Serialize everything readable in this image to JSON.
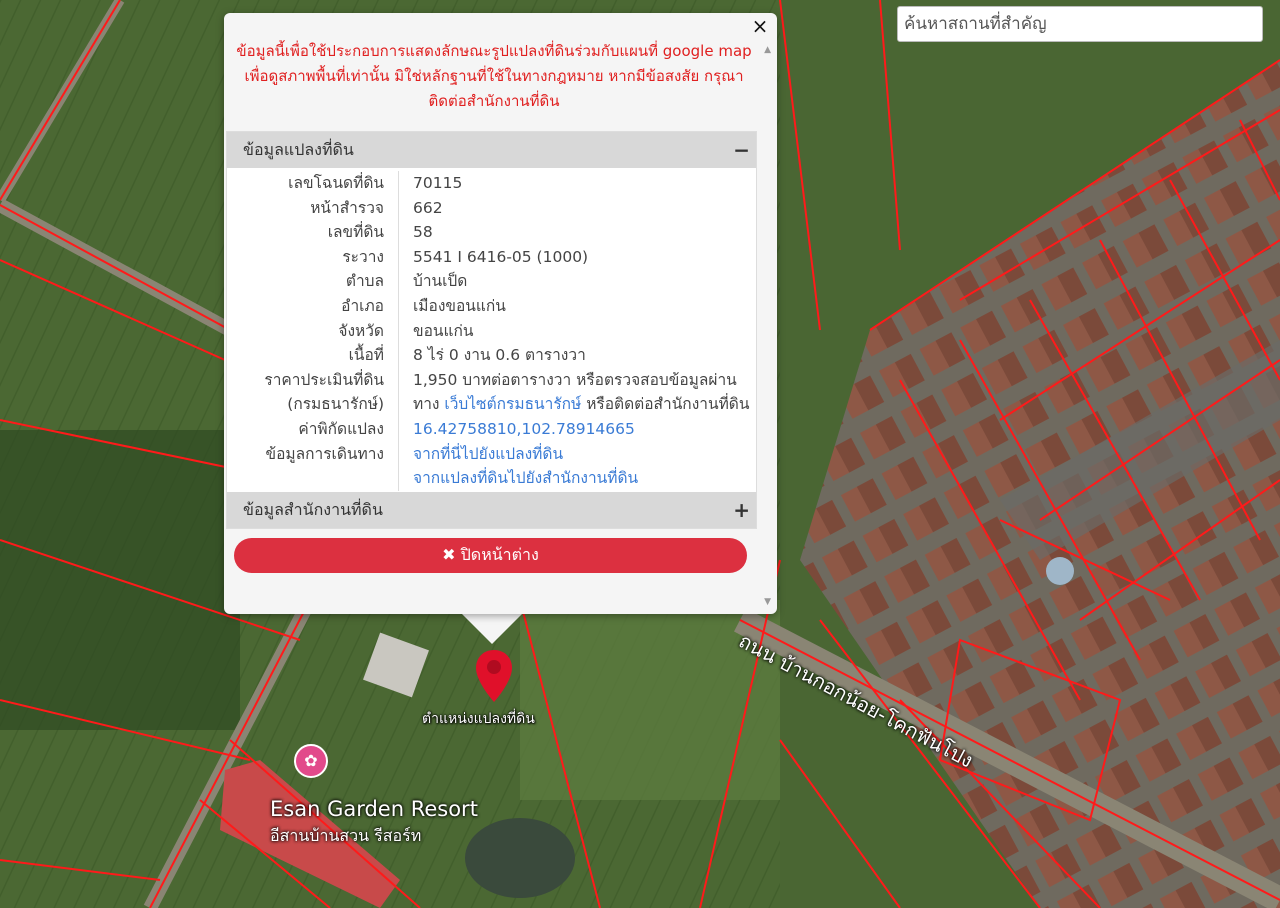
{
  "search": {
    "placeholder": "ค้นหาสถานที่สำคัญ"
  },
  "popup": {
    "close_icon": "×",
    "notice_lines": [
      "ข้อมูลนี้เพื่อใช้ประกอบการแสดงลักษณะรูปแปลงที่ดินร่วมกับแผนที่ google map",
      "เพื่อดูสภาพพื้นที่เท่านั้น มิใช่หลักฐานที่ใช้ในทางกฎหมาย หากมีข้อสงสัย กรุณา",
      "ติดต่อสำนักงานที่ดิน"
    ],
    "land_panel": {
      "title": "ข้อมูลแปลงที่ดิน",
      "toggle": "−",
      "rows": [
        {
          "label": "เลขโฉนดที่ดิน",
          "value": "70115"
        },
        {
          "label": "หน้าสำรวจ",
          "value": "662"
        },
        {
          "label": "เลขที่ดิน",
          "value": "58"
        },
        {
          "label": "ระวาง",
          "value": "5541 I 6416-05 (1000)"
        },
        {
          "label": "ตำบล",
          "value": "บ้านเป็ด"
        },
        {
          "label": "อำเภอ",
          "value": "เมืองขอนแก่น"
        },
        {
          "label": "จังหวัด",
          "value": "ขอนแก่น"
        },
        {
          "label": "เนื้อที่",
          "value": "8 ไร่ 0 งาน 0.6 ตารางวา"
        }
      ],
      "price": {
        "label1": "ราคาประเมินที่ดิน",
        "label2": "(กรมธนารักษ์)",
        "value1": "1,950 บาทต่อตารางวา หรือตรวจสอบข้อมูลผ่าน",
        "value2_pre": "ทาง ",
        "value2_link": "เว็บไซต์กรมธนารักษ์",
        "value2_post": " หรือติดต่อสำนักงานที่ดิน"
      },
      "coord": {
        "label": "ค่าพิกัดแปลง",
        "value": "16.42758810,102.78914665"
      },
      "travel": {
        "label": "ข้อมูลการเดินทาง",
        "link1": "จากที่นี่ไปยังแปลงที่ดิน",
        "link2": "จากแปลงที่ดินไปยังสำนักงานที่ดิน"
      }
    },
    "office_panel": {
      "title": "ข้อมูลสำนักงานที่ดิน",
      "toggle": "+"
    },
    "close_button": {
      "icon": "✖",
      "label": "ปิดหน้าต่าง"
    }
  },
  "map": {
    "pin_label": "ตำแหน่งแปลงที่ดิน",
    "poi_name": "Esan Garden Resort",
    "poi_sub": "อีสานบ้านสวน รีสอร์ท",
    "road_label": "ถนน บ้านกอกน้อย-โคกฟันโปง",
    "pin_color": "#e0102a",
    "poi_icon": "pink-location-icon"
  }
}
